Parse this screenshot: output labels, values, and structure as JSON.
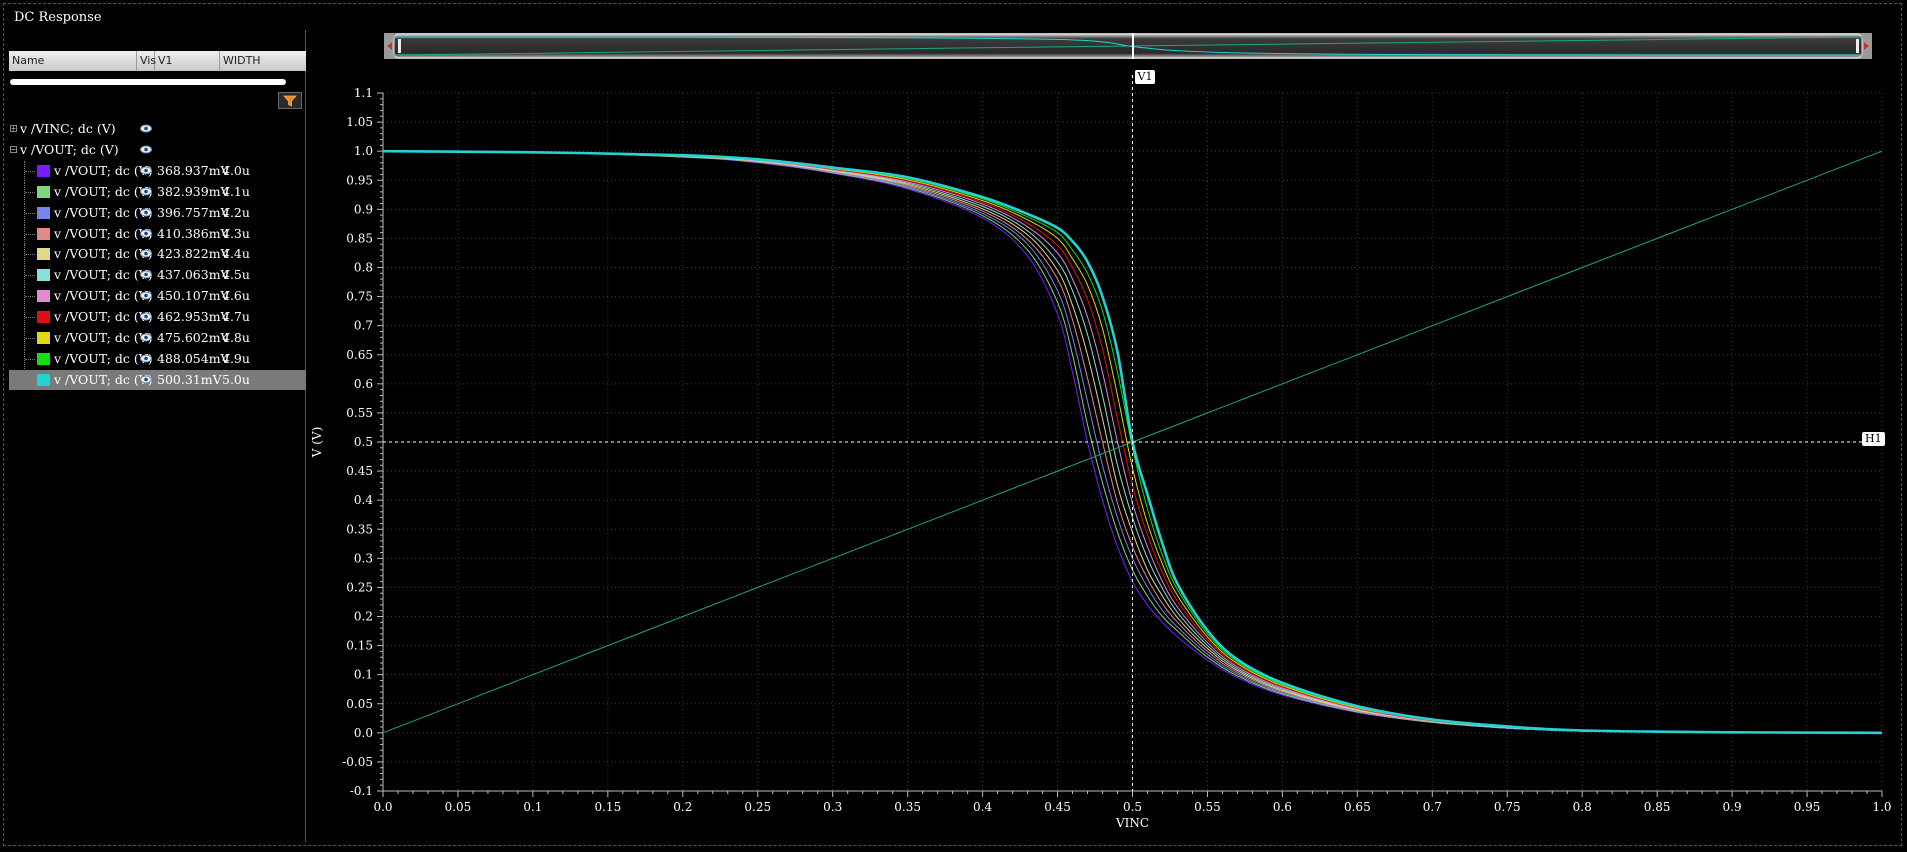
{
  "window": {
    "title": "DC Response"
  },
  "browser": {
    "columns": {
      "name": "Name",
      "vis": "Vis",
      "v1": "V1",
      "width": "WIDTH"
    },
    "groups": [
      {
        "label": "v /VINC; dc (V)",
        "expander": "+"
      },
      {
        "label": "v /VOUT; dc (V)",
        "expander": "−"
      }
    ],
    "signals": [
      {
        "label": "v /VOUT; dc (V)",
        "v1": "368.937mV",
        "width": "4.0u",
        "color": "#7a1bff"
      },
      {
        "label": "v /VOUT; dc (V)",
        "v1": "382.939mV",
        "width": "4.1u",
        "color": "#7fd67a"
      },
      {
        "label": "v /VOUT; dc (V)",
        "v1": "396.757mV",
        "width": "4.2u",
        "color": "#7a86e6"
      },
      {
        "label": "v /VOUT; dc (V)",
        "v1": "410.386mV",
        "width": "4.3u",
        "color": "#e08a8a"
      },
      {
        "label": "v /VOUT; dc (V)",
        "v1": "423.822mV",
        "width": "4.4u",
        "color": "#e0d98a"
      },
      {
        "label": "v /VOUT; dc (V)",
        "v1": "437.063mV",
        "width": "4.5u",
        "color": "#8ae0dc"
      },
      {
        "label": "v /VOUT; dc (V)",
        "v1": "450.107mV",
        "width": "4.6u",
        "color": "#e08ad6"
      },
      {
        "label": "v /VOUT; dc (V)",
        "v1": "462.953mV",
        "width": "4.7u",
        "color": "#e01010"
      },
      {
        "label": "v /VOUT; dc (V)",
        "v1": "475.602mV",
        "width": "4.8u",
        "color": "#e0d810"
      },
      {
        "label": "v /VOUT; dc (V)",
        "v1": "488.054mV",
        "width": "4.9u",
        "color": "#10e010"
      },
      {
        "label": "v /VOUT; dc (V)",
        "v1": "500.31mV",
        "width": "5.0u",
        "color": "#22d3d3"
      }
    ],
    "selected_index": 10
  },
  "markers": {
    "vertical": {
      "label": "V1",
      "x": 0.5
    },
    "horizontal": {
      "label": "H1",
      "y": 0.5
    }
  },
  "chart_data": {
    "type": "line",
    "xlabel": "VINC",
    "ylabel": "V (V)",
    "xlim": [
      0.0,
      1.0
    ],
    "ylim": [
      -0.1,
      1.1
    ],
    "xticks": [
      "0.0",
      "0.05",
      "0.1",
      "0.15",
      "0.2",
      "0.25",
      "0.3",
      "0.35",
      "0.4",
      "0.45",
      "0.5",
      "0.55",
      "0.6",
      "0.65",
      "0.7",
      "0.75",
      "0.8",
      "0.85",
      "0.9",
      "0.95",
      "1.0"
    ],
    "yticks": [
      "-0.1",
      "-0.05",
      "0.0",
      "0.05",
      "0.1",
      "0.15",
      "0.2",
      "0.25",
      "0.3",
      "0.35",
      "0.4",
      "0.45",
      "0.5",
      "0.55",
      "0.6",
      "0.65",
      "0.7",
      "0.75",
      "0.8",
      "0.85",
      "0.9",
      "0.95",
      "1.0",
      "1.05",
      "1.1"
    ],
    "grid": true,
    "x": [
      0.0,
      0.1,
      0.2,
      0.25,
      0.3,
      0.35,
      0.4,
      0.43,
      0.45,
      0.46,
      0.47,
      0.48,
      0.49,
      0.5,
      0.51,
      0.52,
      0.53,
      0.55,
      0.57,
      0.6,
      0.65,
      0.7,
      0.75,
      0.8,
      0.9,
      1.0
    ],
    "series": [
      {
        "name": "v /VOUT; dc (V)",
        "color": "#7a1bff",
        "values": [
          1.0,
          0.998,
          0.99,
          0.98,
          0.962,
          0.935,
          0.885,
          0.82,
          0.72,
          0.62,
          0.5,
          0.4,
          0.32,
          0.26,
          0.22,
          0.19,
          0.165,
          0.125,
          0.095,
          0.065,
          0.035,
          0.018,
          0.008,
          0.003,
          0.001,
          0.0
        ]
      },
      {
        "name": "v /VOUT; dc (V)",
        "color": "#7fd67a",
        "values": [
          1.0,
          0.998,
          0.99,
          0.981,
          0.963,
          0.937,
          0.889,
          0.83,
          0.74,
          0.65,
          0.53,
          0.43,
          0.345,
          0.28,
          0.235,
          0.2,
          0.175,
          0.13,
          0.098,
          0.067,
          0.036,
          0.018,
          0.008,
          0.003,
          0.001,
          0.0
        ]
      },
      {
        "name": "v /VOUT; dc (V)",
        "color": "#7a86e6",
        "values": [
          1.0,
          0.998,
          0.991,
          0.982,
          0.964,
          0.939,
          0.893,
          0.84,
          0.76,
          0.68,
          0.57,
          0.46,
          0.37,
          0.3,
          0.25,
          0.21,
          0.182,
          0.135,
          0.101,
          0.069,
          0.037,
          0.019,
          0.008,
          0.003,
          0.001,
          0.0
        ]
      },
      {
        "name": "v /VOUT; dc (V)",
        "color": "#e08a8a",
        "values": [
          1.0,
          0.998,
          0.991,
          0.982,
          0.965,
          0.941,
          0.897,
          0.848,
          0.78,
          0.71,
          0.61,
          0.5,
          0.395,
          0.32,
          0.265,
          0.222,
          0.19,
          0.14,
          0.104,
          0.071,
          0.038,
          0.019,
          0.009,
          0.003,
          0.001,
          0.0
        ]
      },
      {
        "name": "v /VOUT; dc (V)",
        "color": "#e0d98a",
        "values": [
          1.0,
          0.998,
          0.991,
          0.983,
          0.966,
          0.943,
          0.901,
          0.856,
          0.795,
          0.735,
          0.65,
          0.54,
          0.425,
          0.345,
          0.28,
          0.235,
          0.198,
          0.145,
          0.107,
          0.073,
          0.039,
          0.02,
          0.009,
          0.003,
          0.001,
          0.0
        ]
      },
      {
        "name": "v /VOUT; dc (V)",
        "color": "#8ae0dc",
        "values": [
          1.0,
          0.998,
          0.992,
          0.984,
          0.967,
          0.945,
          0.905,
          0.863,
          0.81,
          0.76,
          0.685,
          0.58,
          0.46,
          0.37,
          0.3,
          0.248,
          0.207,
          0.15,
          0.11,
          0.075,
          0.04,
          0.02,
          0.009,
          0.003,
          0.001,
          0.0
        ]
      },
      {
        "name": "v /VOUT; dc (V)",
        "color": "#e08ad6",
        "values": [
          1.0,
          0.998,
          0.992,
          0.984,
          0.968,
          0.947,
          0.909,
          0.87,
          0.825,
          0.78,
          0.715,
          0.62,
          0.5,
          0.395,
          0.32,
          0.26,
          0.216,
          0.155,
          0.113,
          0.077,
          0.041,
          0.021,
          0.01,
          0.003,
          0.001,
          0.0
        ]
      },
      {
        "name": "v /VOUT; dc (V)",
        "color": "#e01010",
        "values": [
          1.0,
          0.998,
          0.992,
          0.985,
          0.969,
          0.949,
          0.912,
          0.876,
          0.838,
          0.8,
          0.745,
          0.66,
          0.54,
          0.425,
          0.34,
          0.275,
          0.226,
          0.16,
          0.116,
          0.079,
          0.042,
          0.021,
          0.01,
          0.003,
          0.001,
          0.0
        ]
      },
      {
        "name": "v /VOUT; dc (V)",
        "color": "#e0d810",
        "values": [
          1.0,
          0.998,
          0.992,
          0.985,
          0.97,
          0.951,
          0.915,
          0.882,
          0.85,
          0.815,
          0.77,
          0.695,
          0.58,
          0.455,
          0.36,
          0.29,
          0.236,
          0.165,
          0.119,
          0.081,
          0.043,
          0.022,
          0.01,
          0.003,
          0.001,
          0.0
        ]
      },
      {
        "name": "v /VOUT; dc (V)",
        "color": "#10e010",
        "values": [
          1.0,
          0.998,
          0.993,
          0.986,
          0.971,
          0.953,
          0.918,
          0.887,
          0.86,
          0.83,
          0.79,
          0.725,
          0.62,
          0.49,
          0.385,
          0.305,
          0.246,
          0.17,
          0.122,
          0.083,
          0.044,
          0.022,
          0.01,
          0.003,
          0.001,
          0.0
        ]
      },
      {
        "name": "v /VOUT; dc (V)",
        "color": "#22d3d3",
        "values": [
          1.0,
          0.998,
          0.993,
          0.986,
          0.972,
          0.955,
          0.921,
          0.892,
          0.868,
          0.845,
          0.81,
          0.75,
          0.655,
          0.5,
          0.41,
          0.325,
          0.256,
          0.176,
          0.126,
          0.086,
          0.046,
          0.023,
          0.011,
          0.004,
          0.001,
          0.0
        ]
      },
      {
        "name": "v /VINC; dc (V)",
        "color": "#1aa58a",
        "values": [
          0.0,
          0.1,
          0.2,
          0.25,
          0.3,
          0.35,
          0.4,
          0.43,
          0.45,
          0.46,
          0.47,
          0.48,
          0.49,
          0.5,
          0.51,
          0.52,
          0.53,
          0.55,
          0.57,
          0.6,
          0.65,
          0.7,
          0.75,
          0.8,
          0.9,
          1.0
        ]
      }
    ]
  }
}
